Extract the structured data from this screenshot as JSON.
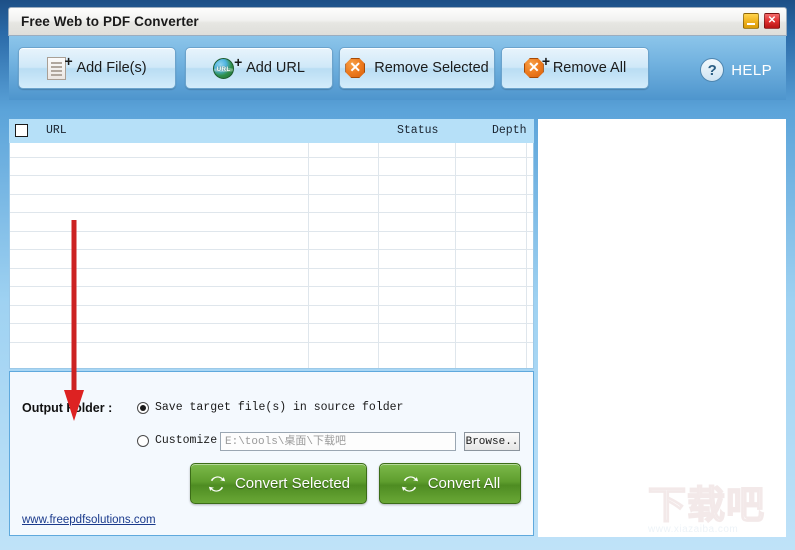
{
  "window": {
    "title": "Free Web to PDF Converter",
    "controls": [
      {
        "name": "minimize-button",
        "glyph": "–"
      },
      {
        "name": "close-button",
        "glyph": "✕"
      }
    ]
  },
  "toolbar": {
    "add_files_label": "Add File(s)",
    "add_url_label": "Add URL",
    "add_url_icon_text": "URL",
    "remove_selected_label": "Remove Selected",
    "remove_all_label": "Remove All",
    "help_label": "HELP",
    "help_icon_glyph": "?",
    "plus_glyph": "+",
    "remove_glyph": "✕"
  },
  "file_list": {
    "select_all_checked": false,
    "columns": [
      "URL",
      "Status",
      "Depth"
    ],
    "rows": []
  },
  "output": {
    "label": "Output Folder :",
    "option_source_label": "Save target file(s) in source folder",
    "option_source_selected": true,
    "option_customize_label": "Customize",
    "option_customize_selected": false,
    "path_value": "E:\\tools\\桌面\\下载吧",
    "browse_label": "Browse.."
  },
  "actions": {
    "convert_selected_label": "Convert Selected",
    "convert_all_label": "Convert All"
  },
  "footer": {
    "site_link": "www.freepdfsolutions.com"
  },
  "watermark": {
    "cn_text": "下载吧",
    "en_text": "www.xiazaiba.com"
  },
  "colors": {
    "window_blue": "#5ba3d9",
    "toolbar_blue": "#73b3e0",
    "header_blue": "#b6e0f8",
    "convert_green": "#5f9e2e",
    "remove_orange": "#ef7f22",
    "link_blue": "#1a3a8c",
    "annotation_red": "#cc2222"
  }
}
